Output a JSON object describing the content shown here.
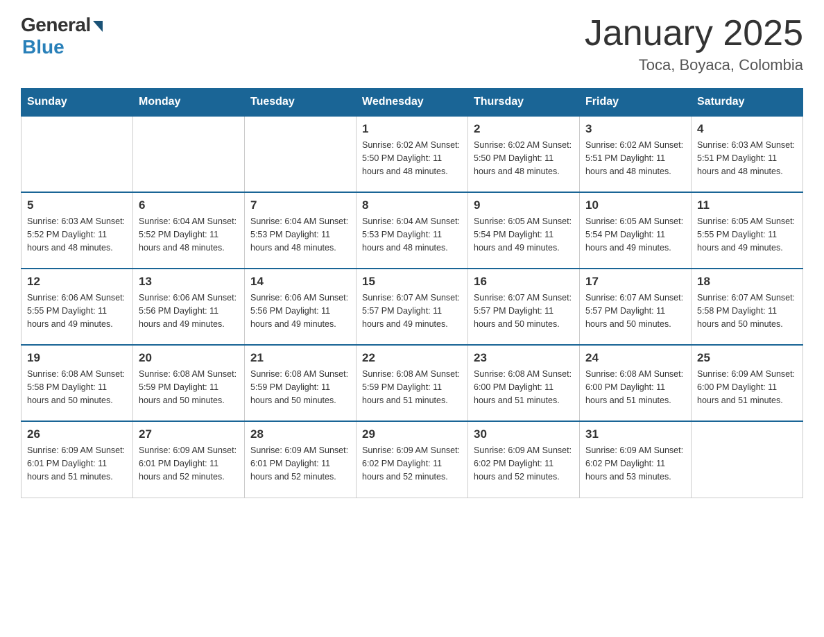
{
  "header": {
    "logo_general": "General",
    "logo_blue": "Blue",
    "title": "January 2025",
    "subtitle": "Toca, Boyaca, Colombia"
  },
  "days_of_week": [
    "Sunday",
    "Monday",
    "Tuesday",
    "Wednesday",
    "Thursday",
    "Friday",
    "Saturday"
  ],
  "weeks": [
    [
      {
        "day": "",
        "info": ""
      },
      {
        "day": "",
        "info": ""
      },
      {
        "day": "",
        "info": ""
      },
      {
        "day": "1",
        "info": "Sunrise: 6:02 AM\nSunset: 5:50 PM\nDaylight: 11 hours and 48 minutes."
      },
      {
        "day": "2",
        "info": "Sunrise: 6:02 AM\nSunset: 5:50 PM\nDaylight: 11 hours and 48 minutes."
      },
      {
        "day": "3",
        "info": "Sunrise: 6:02 AM\nSunset: 5:51 PM\nDaylight: 11 hours and 48 minutes."
      },
      {
        "day": "4",
        "info": "Sunrise: 6:03 AM\nSunset: 5:51 PM\nDaylight: 11 hours and 48 minutes."
      }
    ],
    [
      {
        "day": "5",
        "info": "Sunrise: 6:03 AM\nSunset: 5:52 PM\nDaylight: 11 hours and 48 minutes."
      },
      {
        "day": "6",
        "info": "Sunrise: 6:04 AM\nSunset: 5:52 PM\nDaylight: 11 hours and 48 minutes."
      },
      {
        "day": "7",
        "info": "Sunrise: 6:04 AM\nSunset: 5:53 PM\nDaylight: 11 hours and 48 minutes."
      },
      {
        "day": "8",
        "info": "Sunrise: 6:04 AM\nSunset: 5:53 PM\nDaylight: 11 hours and 48 minutes."
      },
      {
        "day": "9",
        "info": "Sunrise: 6:05 AM\nSunset: 5:54 PM\nDaylight: 11 hours and 49 minutes."
      },
      {
        "day": "10",
        "info": "Sunrise: 6:05 AM\nSunset: 5:54 PM\nDaylight: 11 hours and 49 minutes."
      },
      {
        "day": "11",
        "info": "Sunrise: 6:05 AM\nSunset: 5:55 PM\nDaylight: 11 hours and 49 minutes."
      }
    ],
    [
      {
        "day": "12",
        "info": "Sunrise: 6:06 AM\nSunset: 5:55 PM\nDaylight: 11 hours and 49 minutes."
      },
      {
        "day": "13",
        "info": "Sunrise: 6:06 AM\nSunset: 5:56 PM\nDaylight: 11 hours and 49 minutes."
      },
      {
        "day": "14",
        "info": "Sunrise: 6:06 AM\nSunset: 5:56 PM\nDaylight: 11 hours and 49 minutes."
      },
      {
        "day": "15",
        "info": "Sunrise: 6:07 AM\nSunset: 5:57 PM\nDaylight: 11 hours and 49 minutes."
      },
      {
        "day": "16",
        "info": "Sunrise: 6:07 AM\nSunset: 5:57 PM\nDaylight: 11 hours and 50 minutes."
      },
      {
        "day": "17",
        "info": "Sunrise: 6:07 AM\nSunset: 5:57 PM\nDaylight: 11 hours and 50 minutes."
      },
      {
        "day": "18",
        "info": "Sunrise: 6:07 AM\nSunset: 5:58 PM\nDaylight: 11 hours and 50 minutes."
      }
    ],
    [
      {
        "day": "19",
        "info": "Sunrise: 6:08 AM\nSunset: 5:58 PM\nDaylight: 11 hours and 50 minutes."
      },
      {
        "day": "20",
        "info": "Sunrise: 6:08 AM\nSunset: 5:59 PM\nDaylight: 11 hours and 50 minutes."
      },
      {
        "day": "21",
        "info": "Sunrise: 6:08 AM\nSunset: 5:59 PM\nDaylight: 11 hours and 50 minutes."
      },
      {
        "day": "22",
        "info": "Sunrise: 6:08 AM\nSunset: 5:59 PM\nDaylight: 11 hours and 51 minutes."
      },
      {
        "day": "23",
        "info": "Sunrise: 6:08 AM\nSunset: 6:00 PM\nDaylight: 11 hours and 51 minutes."
      },
      {
        "day": "24",
        "info": "Sunrise: 6:08 AM\nSunset: 6:00 PM\nDaylight: 11 hours and 51 minutes."
      },
      {
        "day": "25",
        "info": "Sunrise: 6:09 AM\nSunset: 6:00 PM\nDaylight: 11 hours and 51 minutes."
      }
    ],
    [
      {
        "day": "26",
        "info": "Sunrise: 6:09 AM\nSunset: 6:01 PM\nDaylight: 11 hours and 51 minutes."
      },
      {
        "day": "27",
        "info": "Sunrise: 6:09 AM\nSunset: 6:01 PM\nDaylight: 11 hours and 52 minutes."
      },
      {
        "day": "28",
        "info": "Sunrise: 6:09 AM\nSunset: 6:01 PM\nDaylight: 11 hours and 52 minutes."
      },
      {
        "day": "29",
        "info": "Sunrise: 6:09 AM\nSunset: 6:02 PM\nDaylight: 11 hours and 52 minutes."
      },
      {
        "day": "30",
        "info": "Sunrise: 6:09 AM\nSunset: 6:02 PM\nDaylight: 11 hours and 52 minutes."
      },
      {
        "day": "31",
        "info": "Sunrise: 6:09 AM\nSunset: 6:02 PM\nDaylight: 11 hours and 53 minutes."
      },
      {
        "day": "",
        "info": ""
      }
    ]
  ]
}
